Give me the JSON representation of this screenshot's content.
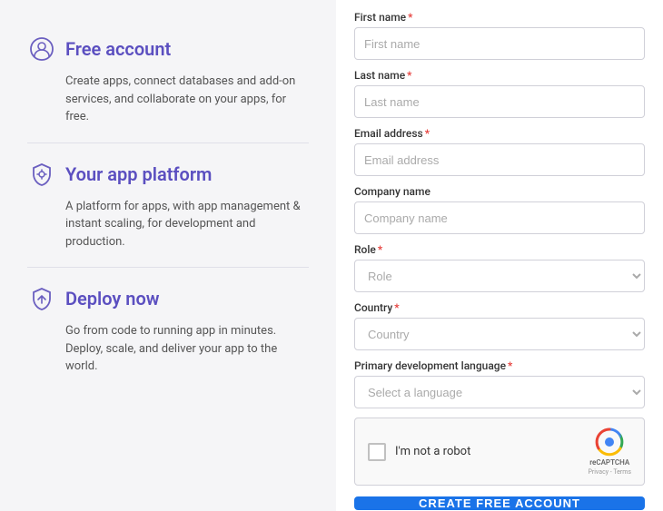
{
  "left": {
    "features": [
      {
        "id": "free-account",
        "icon": "person-circle",
        "title": "Free account",
        "description": "Create apps, connect databases and add-on services, and collaborate on your apps, for free."
      },
      {
        "id": "app-platform",
        "icon": "shield-gear",
        "title": "Your app platform",
        "description": "A platform for apps, with app management & instant scaling, for development and production."
      },
      {
        "id": "deploy-now",
        "icon": "upload-arrow",
        "title": "Deploy now",
        "description": "Go from code to running app in minutes. Deploy, scale, and deliver your app to the world."
      }
    ]
  },
  "form": {
    "fields": {
      "first_name": {
        "label": "First name",
        "placeholder": "First name",
        "required": true
      },
      "last_name": {
        "label": "Last name",
        "placeholder": "Last name",
        "required": true
      },
      "email": {
        "label": "Email address",
        "placeholder": "Email address",
        "required": true
      },
      "company": {
        "label": "Company name",
        "placeholder": "Company name",
        "required": false
      },
      "role": {
        "label": "Role",
        "placeholder": "Role",
        "required": true
      },
      "country": {
        "label": "Country",
        "placeholder": "Country",
        "required": true
      },
      "language": {
        "label": "Primary development language",
        "placeholder": "Select a language",
        "required": true
      }
    },
    "captcha": {
      "label": "I'm not a robot",
      "brand": "reCAPTCHA",
      "links": "Privacy - Terms"
    },
    "submit_label": "CREATE FREE ACCOUNT"
  }
}
